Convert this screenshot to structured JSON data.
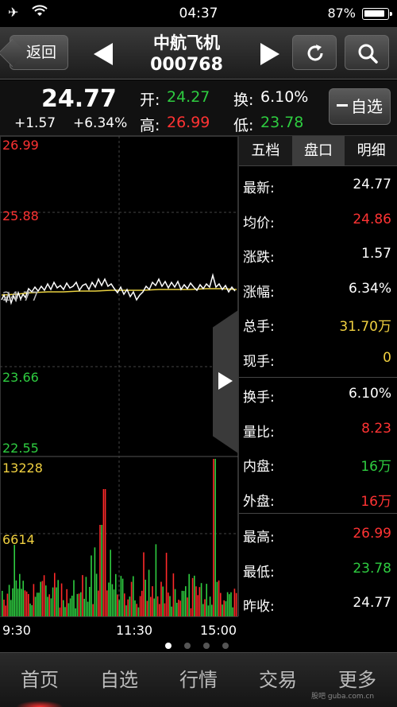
{
  "status": {
    "time": "04:37",
    "battery": "87%"
  },
  "nav": {
    "back_label": "返回",
    "stock_name": "中航飞机",
    "stock_code": "000768"
  },
  "quote": {
    "price": "24.77",
    "change": "+1.57",
    "change_pct": "+6.34%",
    "open_label": "开:",
    "open": "24.27",
    "high_label": "高:",
    "high": "26.99",
    "turnover_label": "换:",
    "turnover": "6.10%",
    "low_label": "低:",
    "low": "23.78",
    "fav_label": "自选"
  },
  "chart": {
    "price_labels": [
      "26.99",
      "25.88",
      "24.77",
      "23.66",
      "22.55"
    ],
    "vol_labels": [
      "13228",
      "6614"
    ],
    "x_labels": [
      "9:30",
      "11:30",
      "15:00"
    ]
  },
  "panel": {
    "tabs": [
      "五档",
      "盘口",
      "明细"
    ],
    "rows": [
      {
        "k": "最新:",
        "v": "24.77",
        "c": "#ffffff"
      },
      {
        "k": "均价:",
        "v": "24.86",
        "c": "#ff3333"
      },
      {
        "k": "涨跌:",
        "v": "1.57",
        "c": "#ffffff"
      },
      {
        "k": "涨幅:",
        "v": "6.34%",
        "c": "#ffffff"
      },
      {
        "k": "总手:",
        "v": "31.70万",
        "c": "#f0d040"
      },
      {
        "k": "现手:",
        "v": "0",
        "c": "#f0d040"
      },
      {
        "k": "换手:",
        "v": "6.10%",
        "c": "#ffffff"
      },
      {
        "k": "量比:",
        "v": "8.23",
        "c": "#ff3333"
      },
      {
        "k": "内盘:",
        "v": "16万",
        "c": "#2ecc40"
      },
      {
        "k": "外盘:",
        "v": "16万",
        "c": "#ff3333"
      },
      {
        "k": "最高:",
        "v": "26.99",
        "c": "#ff3333"
      },
      {
        "k": "最低:",
        "v": "23.78",
        "c": "#2ecc40"
      },
      {
        "k": "昨收:",
        "v": "24.77",
        "c": "#ffffff"
      }
    ]
  },
  "tabbar": [
    "首页",
    "自选",
    "行情",
    "交易",
    "更多"
  ],
  "watermark": "股吧 guba.com.cn"
}
